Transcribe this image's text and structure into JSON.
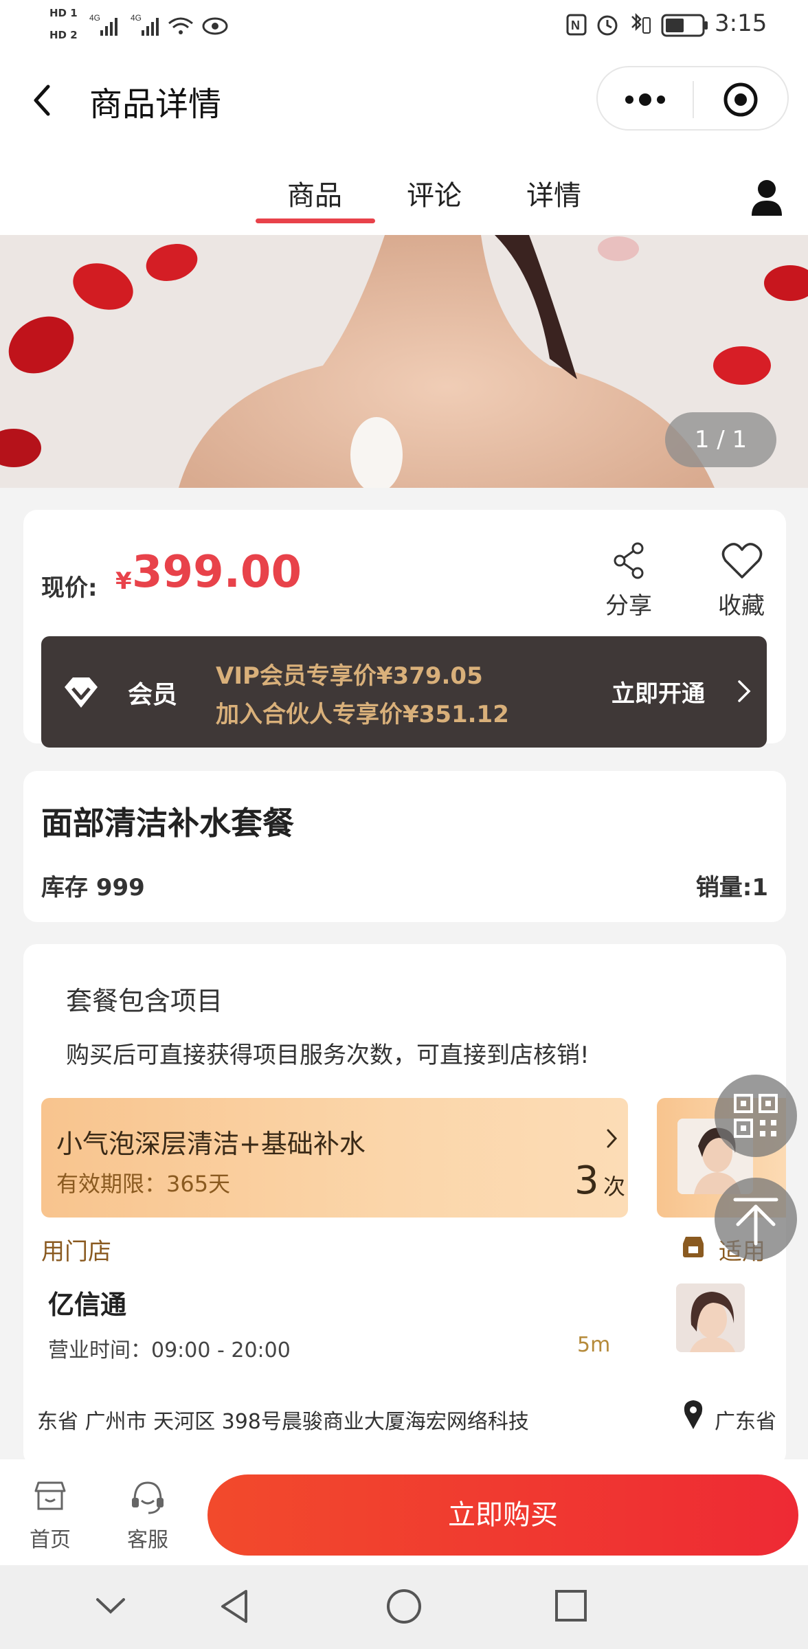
{
  "status_bar": {
    "hd1": "HD 1",
    "hd2": "HD 2",
    "network": "4G",
    "time": "3:15"
  },
  "nav": {
    "title": "商品详情",
    "back_icon": "back-arrow-icon",
    "more_icon": "more-dots-icon",
    "close_icon": "target-close-icon"
  },
  "tabs": [
    {
      "label": "商品",
      "active": true
    },
    {
      "label": "评论",
      "active": false
    },
    {
      "label": "详情",
      "active": false
    }
  ],
  "hero": {
    "pager": "1 / 1"
  },
  "price": {
    "label": "现价:",
    "currency": "¥",
    "value": "399.00",
    "share_label": "分享",
    "collect_label": "收藏"
  },
  "vip": {
    "label": "会员",
    "vip_price": "VIP会员专享价¥379.05",
    "partner_price": "加入合伙人专享价¥351.12",
    "cta": "立即开通"
  },
  "product": {
    "name": "面部清洁补水套餐",
    "stock": "库存 999",
    "sales": "销量:1"
  },
  "package": {
    "title": "套餐包含项目",
    "desc": "购买后可直接获得项目服务次数，可直接到店核销!",
    "service": {
      "name": "小气泡深层清洁+基础补水",
      "validity": "有效期限：365天",
      "count": "3",
      "unit": "次"
    }
  },
  "store": {
    "label": "用门店",
    "label_right": "适用",
    "name": "亿信通",
    "hours": "营业时间：09:00 - 20:00",
    "distance": "5m",
    "address": "东省 广州市 天河区 398号晨骏商业大厦海宏网络科技",
    "address_right": "广东省"
  },
  "bottom": {
    "home_label": "首页",
    "service_label": "客服",
    "buy_label": "立即购买"
  },
  "colors": {
    "accent": "#e8424a",
    "vip_bg": "#3f3837",
    "vip_text": "#d9b07a",
    "buy_gradient_start": "#f24a2c",
    "buy_gradient_end": "#ee2a34"
  }
}
